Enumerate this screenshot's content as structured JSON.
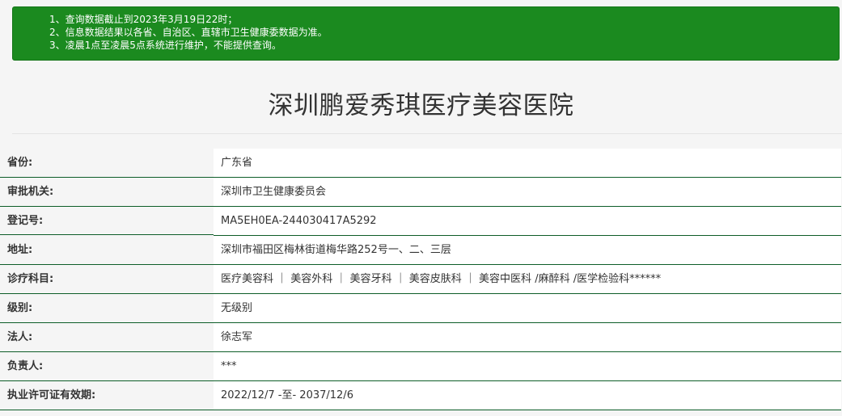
{
  "notice": {
    "lines": [
      "1、查询数据截止到2023年3月19日22时；",
      "2、信息数据结果以各省、自治区、直辖市卫生健康委数据为准。",
      "3、凌晨1点至凌晨5点系统进行维护，不能提供查询。"
    ]
  },
  "title": "深圳鹏爱秀琪医疗美容医院",
  "colors": {
    "notice_bg": "#1b8a1f",
    "row_border": "#0d5d28",
    "page_bg": "#f5f5f5"
  },
  "fields": [
    {
      "label": "省份:",
      "value": "广东省"
    },
    {
      "label": "审批机关:",
      "value": "深圳市卫生健康委员会"
    },
    {
      "label": "登记号:",
      "value": "MA5EH0EA-244030417A5292"
    },
    {
      "label": "地址:",
      "value": "深圳市福田区梅林街道梅华路252号一、二、三层"
    },
    {
      "label": "诊疗科目:",
      "value": "医疗美容科 ｜ 美容外科 ｜ 美容牙科 ｜ 美容皮肤科 ｜ 美容中医科 /麻醉科 /医学检验科******"
    },
    {
      "label": "级别:",
      "value": "无级别"
    },
    {
      "label": "法人:",
      "value": "徐志军"
    },
    {
      "label": "负责人:",
      "value": "***"
    },
    {
      "label": "执业许可证有效期:",
      "value": "2022/12/7 -至- 2037/12/6"
    }
  ]
}
